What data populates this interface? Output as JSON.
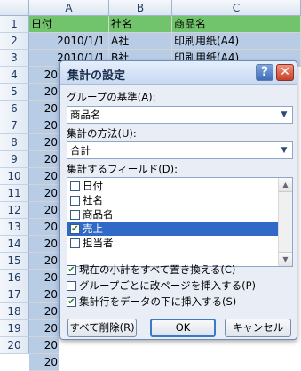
{
  "sheet": {
    "columns": [
      "A",
      "B",
      "C"
    ],
    "rows": [
      "1",
      "2",
      "3",
      "4",
      "5",
      "6",
      "7",
      "8",
      "9",
      "10",
      "11",
      "12",
      "13",
      "14",
      "15",
      "16",
      "17",
      "18",
      "19",
      "20"
    ],
    "header_row": [
      "日付",
      "社名",
      "商品名"
    ],
    "row2": [
      "2010/1/1",
      "A社",
      "印刷用紙(A4)"
    ],
    "row3": [
      "2010/1/1",
      "B社",
      "印刷用紙(A4)"
    ],
    "col_a_partial": [
      "20",
      "20",
      "20",
      "20",
      "20",
      "20",
      "20",
      "20",
      "20",
      "20",
      "20",
      "20",
      "20",
      "20",
      "20",
      "20",
      "20",
      "20"
    ],
    "header_color": "#72c46c",
    "selection_color": "#b8cce6"
  },
  "dialog": {
    "title": "集計の設定",
    "help_label": "?",
    "close_label": "✕",
    "group_label": "グループの基準(A):",
    "group_value": "商品名",
    "method_label": "集計の方法(U):",
    "method_value": "合計",
    "fields_label": "集計するフィールド(D):",
    "fields": [
      {
        "label": "日付",
        "checked": false,
        "selected": false
      },
      {
        "label": "社名",
        "checked": false,
        "selected": false
      },
      {
        "label": "商品名",
        "checked": false,
        "selected": false
      },
      {
        "label": "売上",
        "checked": true,
        "selected": true
      },
      {
        "label": "担当者",
        "checked": false,
        "selected": false
      }
    ],
    "options": [
      {
        "label": "現在の小計をすべて置き換える(C)",
        "checked": true
      },
      {
        "label": "グループごとに改ページを挿入する(P)",
        "checked": false
      },
      {
        "label": "集計行をデータの下に挿入する(S)",
        "checked": true
      }
    ],
    "buttons": {
      "remove_all": "すべて削除(R)",
      "ok": "OK",
      "cancel": "キャンセル"
    },
    "check_mark": "✔"
  }
}
